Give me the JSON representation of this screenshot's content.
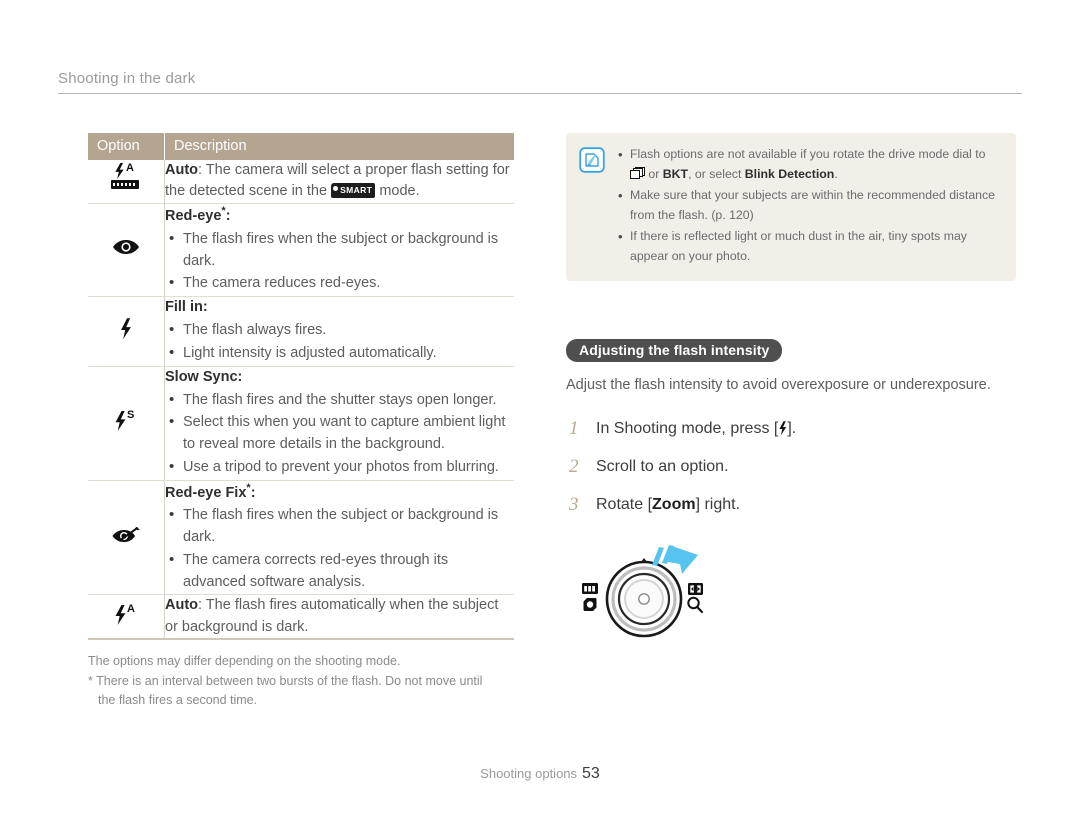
{
  "header": {
    "title": "Shooting in the dark"
  },
  "table": {
    "columns": [
      "Option",
      "Description"
    ],
    "rows": [
      {
        "icon": "flash-auto-smart-icon",
        "title": "Auto",
        "title_sup": "",
        "lead": ": The camera will select a proper flash setting for the detected scene in the",
        "lead_tail": "mode.",
        "smart_badge": "SMART",
        "bullets": []
      },
      {
        "icon": "red-eye-icon",
        "title": "Red-eye",
        "title_sup": "*",
        "title_colon": ":",
        "bullets": [
          "The flash fires when the subject or background is dark.",
          "The camera reduces red-eyes."
        ]
      },
      {
        "icon": "flash-fill-in-icon",
        "title": "Fill in",
        "title_sup": "",
        "title_colon": ":",
        "bullets": [
          "The flash always fires.",
          "Light intensity is adjusted automatically."
        ]
      },
      {
        "icon": "flash-slow-sync-icon",
        "title": "Slow Sync",
        "title_sup": "",
        "title_colon": ":",
        "bullets": [
          "The flash fires and the shutter stays open longer.",
          "Select this when you want to capture ambient light to reveal more details in the background.",
          "Use a tripod to prevent your photos from blurring."
        ]
      },
      {
        "icon": "red-eye-fix-icon",
        "title": "Red-eye Fix",
        "title_sup": "*",
        "title_colon": ":",
        "bullets": [
          "The flash fires when the subject or background is dark.",
          "The camera corrects red-eyes through its advanced software analysis."
        ]
      },
      {
        "icon": "flash-auto-icon",
        "title": "Auto",
        "title_sup": "",
        "lead": ": The flash fires automatically when the subject or background is dark.",
        "bullets": []
      }
    ]
  },
  "table_notes": {
    "line1": "The options may differ depending on the shooting mode.",
    "line2": "* There is an interval between two bursts of the flash. Do not move until",
    "line3": "the flash fires a second time."
  },
  "note_box": {
    "icon": "note-pen-icon",
    "items": [
      {
        "pre": "Flash options are not available if you rotate the drive mode dial to",
        "icon": "burst-drive-icon",
        "mid": "or",
        "bold1": "BKT",
        "mid2": ", or select",
        "bold2": "Blink Detection",
        "post": "."
      },
      {
        "text": "Make sure that your subjects are within the recommended distance from the flash. (p. 120)"
      },
      {
        "text": "If there is reflected light or much dust in the air, tiny spots may appear on your photo."
      }
    ]
  },
  "section": {
    "heading": "Adjusting the flash intensity",
    "intro": "Adjust the flash intensity to avoid overexposure or underexposure.",
    "steps": [
      {
        "num": "1",
        "pre": "In Shooting mode, press [",
        "icon": "flash-bolt-icon",
        "post": "]."
      },
      {
        "num": "2",
        "pre": "Scroll to an option.",
        "post": ""
      },
      {
        "num": "3",
        "pre": "Rotate [",
        "bold": "Zoom",
        "post": "] right."
      }
    ],
    "figure": {
      "name": "zoom-dial-figure",
      "left_icons": [
        "thumbnail-grid-icon",
        "wide-angle-icon"
      ],
      "right_icons": [
        "telephoto-icon",
        "magnifier-icon"
      ],
      "arrow": "rotate-right-arrow",
      "arrow_color": "#57c3ef"
    }
  },
  "footer": {
    "label": "Shooting options",
    "page": "53"
  },
  "colors": {
    "table_header_bg": "#b3a590",
    "note_box_bg": "#f2efe9",
    "pill_bg": "#4f4f4f",
    "step_number": "#b7a992",
    "arrow_blue": "#57c3ef"
  }
}
